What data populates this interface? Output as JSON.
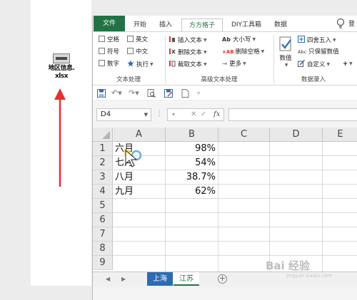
{
  "desktop": {
    "file_name_line1": "地区信息.",
    "file_name_line2": "xlsx"
  },
  "ribbon_tabs": [
    "文件",
    "开始",
    "插入",
    "方方格子",
    "DIY工具箱",
    "数据"
  ],
  "active_tab": "方方格子",
  "user_label": "登",
  "ribbon": {
    "text_group": {
      "items": [
        "空格",
        "英文",
        "符号",
        "中文",
        "数字",
        "执行"
      ],
      "label": "文本处理"
    },
    "adv_group": {
      "items": [
        "插入文本",
        "删除文本",
        "截取文本",
        "大小写",
        "删除空格",
        "更多"
      ],
      "label": "高级文本处理"
    },
    "data_group": {
      "big_button": "数值",
      "items": [
        "四舍五入",
        "只保留数值",
        "自定义"
      ],
      "label": "数据录入"
    }
  },
  "formula_bar": {
    "name_box": "D4",
    "fx": "fx"
  },
  "grid": {
    "columns": [
      "A",
      "B",
      "C",
      "D",
      "E"
    ],
    "rows": [
      "1",
      "2",
      "3",
      "4",
      "5",
      "6",
      "7",
      "8",
      "9"
    ],
    "cells": [
      {
        "a": "六月",
        "b": "98%"
      },
      {
        "a": "七月",
        "b": "54%"
      },
      {
        "a": "八月",
        "b": "38.7%"
      },
      {
        "a": "九月",
        "b": "62%"
      }
    ]
  },
  "sheets": [
    "上海",
    "江苏"
  ],
  "active_sheet": "江苏",
  "watermark": "Bai 经验",
  "watermark_sub": "jingyan.baidu.com",
  "colors": {
    "excel_green": "#217346",
    "sheet_tab_blue": "#2d6bb3",
    "arrow_red": "#e5322d"
  }
}
